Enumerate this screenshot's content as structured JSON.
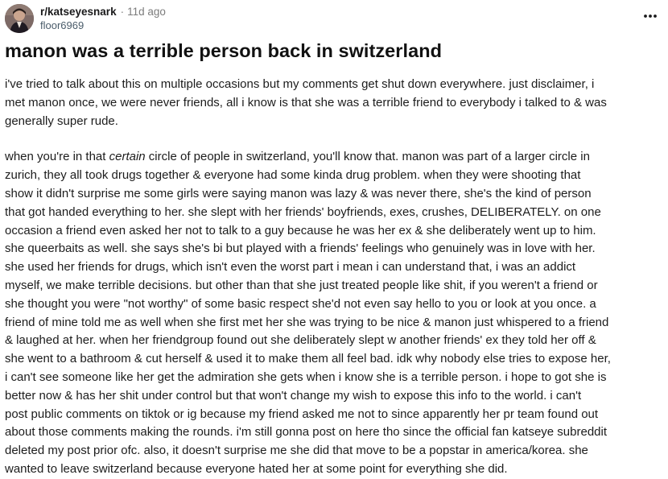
{
  "post": {
    "community": "r/katseyesnark",
    "separator": "·",
    "time_ago": "11d ago",
    "author": "floor6969",
    "more_icon": "more-horizontal-icon",
    "title": "manon was a terrible person back in switzerland",
    "paragraph1": [
      "i've tried to talk about this on multiple occasions but my comments get shut down everywhere. just disclaimer, i",
      "met manon once, we were never friends, all i know is that she was a terrible friend to everybody i talked to & was",
      "generally super rude."
    ],
    "paragraph2_line1_pre": "when you're in that ",
    "paragraph2_line1_em": "certain",
    "paragraph2_line1_post": " circle of people in switzerland, you'll know that. manon was part of a larger circle in",
    "paragraph2": [
      "zurich, they all took drugs together & everyone had some kinda drug problem. when they were shooting that",
      "show it didn't surprise me some girls were saying manon was lazy & was never there, she's the kind of person",
      "that got handed everything to her. she slept with her friends' boyfriends, exes, crushes, DELIBERATELY. on one",
      "occasion a friend even asked her not to talk to a guy because he was her ex & she deliberately went up to him.",
      "she queerbaits as well. she says she's bi but played with a friends' feelings who genuinely was in love with her.",
      "she used her friends for drugs, which isn't even the worst part i mean i can understand that, i was an addict",
      "myself, we make terrible decisions. but other than that she just treated people like shit, if you weren't a friend or",
      "she thought you were \"not worthy\" of some basic respect she'd not even say hello to you or look at you once. a",
      "friend of mine told me as well when she first met her she was trying to be nice & manon just whispered to a friend",
      "& laughed at her. when her friendgroup found out she deliberately slept w another friends' ex they told her off &",
      "she went to a bathroom & cut herself & used it to make them all feel bad. idk why nobody else tries to expose her,",
      "i can't see someone like her get the admiration she gets when i know she is a terrible person. i hope to got she is",
      "better now & has her shit under control but that won't change my wish to expose this info to the world. i can't",
      "post public comments on tiktok or ig because my friend asked me not to since apparently her pr team found out",
      "about those comments making the rounds. i'm still gonna post on here tho since the official fan katseye subreddit",
      "deleted my post prior ofc. also, it doesn't surprise me she did that move to be a popstar in america/korea. she",
      "wanted to leave switzerland because everyone hated her at some point for everything she did."
    ]
  }
}
